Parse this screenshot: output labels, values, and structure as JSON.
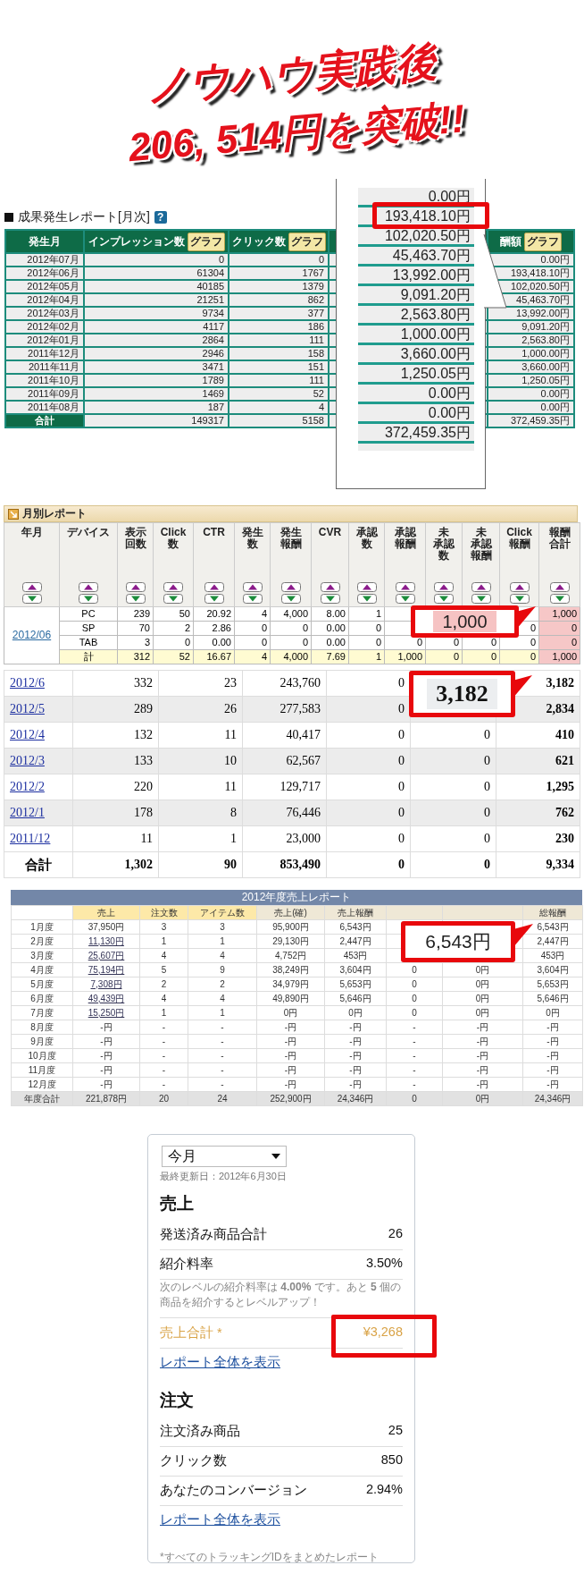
{
  "headline": {
    "lines": [
      "ノウハウ実践後",
      "206, 514円を突破!!"
    ]
  },
  "report1": {
    "title": "成果発生レポート[月次]",
    "help": "?",
    "columns": [
      {
        "label": "発生月"
      },
      {
        "label": "インプレッション数",
        "button": "グラフ"
      },
      {
        "label": "クリック数",
        "button": "グラフ"
      },
      {
        "label": "酬額",
        "button": "グラフ"
      }
    ],
    "rows": [
      {
        "month": "2012年07月",
        "impressions": "0",
        "clicks": "0",
        "reward": "0.00円"
      },
      {
        "month": "2012年06月",
        "impressions": "61304",
        "clicks": "1767",
        "reward": "193,418.10円"
      },
      {
        "month": "2012年05月",
        "impressions": "40185",
        "clicks": "1379",
        "reward": "102,020.50円"
      },
      {
        "month": "2012年04月",
        "impressions": "21251",
        "clicks": "862",
        "reward": "45,463.70円"
      },
      {
        "month": "2012年03月",
        "impressions": "9734",
        "clicks": "377",
        "reward": "13,992.00円"
      },
      {
        "month": "2012年02月",
        "impressions": "4117",
        "clicks": "186",
        "reward": "9,091.20円"
      },
      {
        "month": "2012年01月",
        "impressions": "2864",
        "clicks": "111",
        "reward": "2,563.80円"
      },
      {
        "month": "2011年12月",
        "impressions": "2946",
        "clicks": "158",
        "reward": "1,000.00円"
      },
      {
        "month": "2011年11月",
        "impressions": "3471",
        "clicks": "151",
        "reward": "3,660.00円"
      },
      {
        "month": "2011年10月",
        "impressions": "1789",
        "clicks": "111",
        "reward": "1,250.05円"
      },
      {
        "month": "2011年09月",
        "impressions": "1469",
        "clicks": "52",
        "reward": "0.00円"
      },
      {
        "month": "2011年08月",
        "impressions": "187",
        "clicks": "4",
        "reward": "0.00円"
      }
    ],
    "total": {
      "label": "合計",
      "impressions": "149317",
      "clicks": "5158",
      "reward": "372,459.35円"
    },
    "magnifier": {
      "amounts": [
        {
          "text": "0.00円",
          "highlighted": false
        },
        {
          "text": "193,418.10円",
          "highlighted": true
        },
        {
          "text": "102,020.50円",
          "highlighted": false
        },
        {
          "text": "45,463.70円",
          "highlighted": false
        },
        {
          "text": "13,992.00円",
          "highlighted": false
        },
        {
          "text": "9,091.20円",
          "highlighted": false
        },
        {
          "text": "2,563.80円",
          "highlighted": false
        },
        {
          "text": "1,000.00円",
          "highlighted": false
        },
        {
          "text": "3,660.00円",
          "highlighted": false
        },
        {
          "text": "1,250.05円",
          "highlighted": false
        },
        {
          "text": "0.00円",
          "highlighted": false
        },
        {
          "text": "0.00円",
          "highlighted": false
        },
        {
          "text": "372,459.35円",
          "highlighted": false
        }
      ]
    }
  },
  "report2": {
    "title": "月別レポート",
    "columns": [
      {
        "lines": [
          "年月"
        ]
      },
      {
        "lines": [
          "デバイス"
        ]
      },
      {
        "lines": [
          "表示",
          "回数"
        ]
      },
      {
        "lines": [
          "Click",
          "数"
        ]
      },
      {
        "lines": [
          "CTR"
        ]
      },
      {
        "lines": [
          "発生",
          "数"
        ]
      },
      {
        "lines": [
          "発生",
          "報酬"
        ]
      },
      {
        "lines": [
          "CVR"
        ]
      },
      {
        "lines": [
          "承認",
          "数"
        ]
      },
      {
        "lines": [
          "承認",
          "報酬"
        ]
      },
      {
        "lines": [
          "未",
          "承認",
          "数"
        ]
      },
      {
        "lines": [
          "未",
          "承認",
          "報酬"
        ]
      },
      {
        "lines": [
          "Click",
          "報酬"
        ]
      },
      {
        "lines": [
          "報酬",
          "合計"
        ]
      }
    ],
    "group": {
      "month": "2012/06",
      "rows": [
        {
          "kind": "device",
          "cells": [
            "PC",
            "239",
            "50",
            "20.92",
            "4",
            "4,000",
            "8.00",
            "1",
            null,
            null,
            null,
            null,
            "1,000"
          ]
        },
        {
          "kind": "device",
          "cells": [
            "SP",
            "70",
            "2",
            "2.86",
            "0",
            "0",
            "0.00",
            "0",
            null,
            null,
            null,
            "0",
            "0"
          ]
        },
        {
          "kind": "device",
          "cells": [
            "TAB",
            "3",
            "0",
            "0.00",
            "0",
            "0",
            "0.00",
            "0",
            "0",
            "0",
            "0",
            "0",
            "0"
          ]
        },
        {
          "kind": "total",
          "cells": [
            "計",
            "312",
            "52",
            "16.67",
            "4",
            "4,000",
            "7.69",
            "1",
            "1,000",
            "0",
            "0",
            "0",
            "1,000"
          ]
        }
      ]
    },
    "callout": {
      "value": "1,000"
    },
    "months": [
      {
        "kind": "month",
        "label": "2012/6",
        "cells": [
          "332",
          "23",
          "243,760",
          "0",
          null,
          "3,182"
        ]
      },
      {
        "kind": "month",
        "label": "2012/5",
        "cells": [
          "289",
          "26",
          "277,583",
          "0",
          null,
          "2,834"
        ]
      },
      {
        "kind": "month",
        "label": "2012/4",
        "cells": [
          "132",
          "11",
          "40,417",
          "0",
          "0",
          "410"
        ]
      },
      {
        "kind": "month",
        "label": "2012/3",
        "cells": [
          "133",
          "10",
          "62,567",
          "0",
          "0",
          "621"
        ]
      },
      {
        "kind": "month",
        "label": "2012/2",
        "cells": [
          "220",
          "11",
          "129,717",
          "0",
          "0",
          "1,295"
        ]
      },
      {
        "kind": "month",
        "label": "2012/1",
        "cells": [
          "178",
          "8",
          "76,446",
          "0",
          "0",
          "762"
        ]
      },
      {
        "kind": "month",
        "label": "2011/12",
        "cells": [
          "11",
          "1",
          "23,000",
          "0",
          "0",
          "230"
        ]
      },
      {
        "kind": "total",
        "label": "合計",
        "cells": [
          "1,302",
          "90",
          "853,490",
          "0",
          "0",
          "9,334"
        ]
      }
    ],
    "callout2": {
      "value": "3,182"
    }
  },
  "report3": {
    "title": "2012年度売上レポート",
    "columns": [
      {
        "label": "売上",
        "highlight": true
      },
      {
        "label": "注文数",
        "highlight": true
      },
      {
        "label": "アイテム数",
        "highlight": true
      },
      {
        "label": "売上(確)",
        "highlight": false
      },
      {
        "label": "売上報酬",
        "highlight": false
      },
      {
        "highlight": false
      },
      {
        "highlight": false
      },
      {
        "label": "総報酬",
        "highlight": false
      }
    ],
    "rows": [
      {
        "kind": "month",
        "label": "1月度",
        "link": false,
        "cells": [
          "37,950円",
          "3",
          "3",
          "95,900円",
          "6,543円",
          null,
          null,
          "6,543円"
        ]
      },
      {
        "kind": "month",
        "label": "2月度",
        "link": true,
        "cells": [
          "11,130円",
          "1",
          "1",
          "29,130円",
          "2,447円",
          null,
          null,
          "2,447円"
        ]
      },
      {
        "kind": "month",
        "label": "3月度",
        "link": true,
        "cells": [
          "25,607円",
          "4",
          "4",
          "4,752円",
          "453円",
          null,
          null,
          "453円"
        ]
      },
      {
        "kind": "month",
        "label": "4月度",
        "link": true,
        "cells": [
          "75,194円",
          "5",
          "9",
          "38,249円",
          "3,604円",
          "0",
          "0円",
          "3,604円"
        ]
      },
      {
        "kind": "month",
        "label": "5月度",
        "link": true,
        "cells": [
          "7,308円",
          "2",
          "2",
          "34,979円",
          "5,653円",
          "0",
          "0円",
          "5,653円"
        ]
      },
      {
        "kind": "month",
        "label": "6月度",
        "link": true,
        "cells": [
          "49,439円",
          "4",
          "4",
          "49,890円",
          "5,646円",
          "0",
          "0円",
          "5,646円"
        ]
      },
      {
        "kind": "month",
        "label": "7月度",
        "link": true,
        "cells": [
          "15,250円",
          "1",
          "1",
          "0円",
          "0円",
          "0",
          "0円",
          "0円"
        ]
      },
      {
        "kind": "month",
        "label": "8月度",
        "link": false,
        "cells": [
          "-円",
          "-",
          "-",
          "-円",
          "-円",
          "-",
          "-円",
          "-円"
        ]
      },
      {
        "kind": "month",
        "label": "9月度",
        "link": false,
        "cells": [
          "-円",
          "-",
          "-",
          "-円",
          "-円",
          "-",
          "-円",
          "-円"
        ]
      },
      {
        "kind": "month",
        "label": "10月度",
        "link": false,
        "cells": [
          "-円",
          "-",
          "-",
          "-円",
          "-円",
          "-",
          "-円",
          "-円"
        ]
      },
      {
        "kind": "month",
        "label": "11月度",
        "link": false,
        "cells": [
          "-円",
          "-",
          "-",
          "-円",
          "-円",
          "-",
          "-円",
          "-円"
        ]
      },
      {
        "kind": "month",
        "label": "12月度",
        "link": false,
        "cells": [
          "-円",
          "-",
          "-",
          "-円",
          "-円",
          "-",
          "-円",
          "-円"
        ]
      },
      {
        "kind": "total",
        "label": "年度合計",
        "link": false,
        "cells": [
          "221,878円",
          "20",
          "24",
          "252,900円",
          "24,346円",
          "0",
          "0円",
          "24,346円"
        ]
      }
    ],
    "callout": {
      "value": "6,543円"
    }
  },
  "widget": {
    "period": "今月",
    "updated": "最終更新日：2012年6月30日",
    "sections": [
      {
        "heading": "売上",
        "items": [
          {
            "kind": "row",
            "label": "発送済み商品合計",
            "value": "26"
          },
          {
            "kind": "row",
            "label": "紹介料率",
            "value": "3.50%"
          },
          {
            "kind": "note",
            "text": "次のレベルの紹介料率は **4.00%** です。あと **5** 個の商品を紹介するとレベルアップ！"
          },
          {
            "kind": "total",
            "label": "売上合計 *",
            "value": "¥3,268"
          },
          {
            "kind": "link",
            "text": "レポート全体を表示"
          }
        ]
      },
      {
        "heading": "注文",
        "items": [
          {
            "kind": "row",
            "label": "注文済み商品",
            "value": "25"
          },
          {
            "kind": "row",
            "label": "クリック数",
            "value": "850"
          },
          {
            "kind": "row",
            "label": "あなたのコンバージョン",
            "value": "2.94%"
          },
          {
            "kind": "link",
            "text": "レポート全体を表示"
          }
        ]
      }
    ],
    "footnote": "*すべてのトラッキングIDをまとめたレポート"
  }
}
